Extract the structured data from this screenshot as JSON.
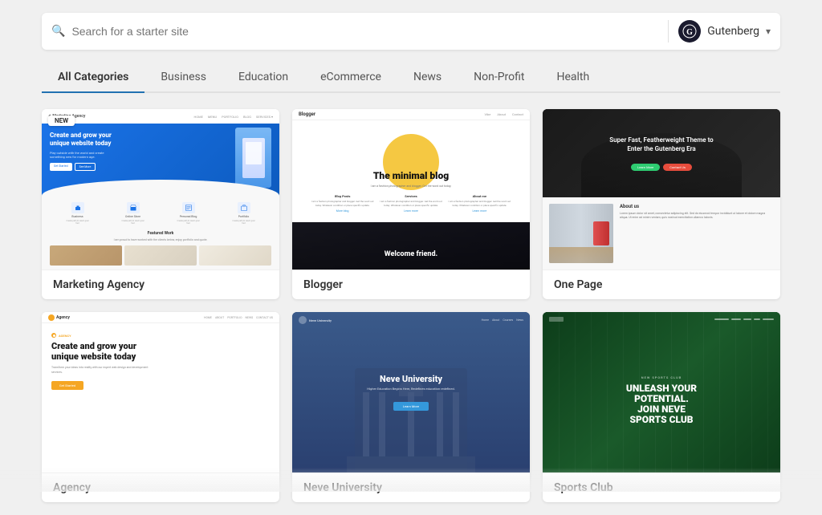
{
  "search": {
    "placeholder": "Search for a starter site"
  },
  "selector": {
    "logo_text": "G",
    "label": "Gutenberg",
    "chevron": "▾"
  },
  "categories": {
    "tabs": [
      {
        "id": "all",
        "label": "All Categories",
        "active": true
      },
      {
        "id": "business",
        "label": "Business",
        "active": false
      },
      {
        "id": "education",
        "label": "Education",
        "active": false
      },
      {
        "id": "ecommerce",
        "label": "eCommerce",
        "active": false
      },
      {
        "id": "news",
        "label": "News",
        "active": false
      },
      {
        "id": "nonprofit",
        "label": "Non-Profit",
        "active": false
      },
      {
        "id": "health",
        "label": "Health",
        "active": false
      }
    ]
  },
  "templates": {
    "row1": [
      {
        "id": "marketing-agency",
        "name": "Marketing Agency",
        "badge": "NEW",
        "hero_text": "Create and grow your unique website today"
      },
      {
        "id": "blogger",
        "name": "Blogger",
        "title": "The minimal blog",
        "bottom_text": "Welcome friend."
      },
      {
        "id": "one-page",
        "name": "One Page",
        "hero_text": "Super Fast, Featherweight Theme to Enter the Gutenberg Era",
        "about_title": "About us"
      }
    ],
    "row2": [
      {
        "id": "agency",
        "name": "Agency",
        "badge_label": "AGENCY",
        "hero_title": "Create and grow your unique website today",
        "hero_sub": "Transform your ideas into reality with our expert web design and development services."
      },
      {
        "id": "neve-university",
        "name": "Neve University",
        "subtitle": "Higher Education Begins Here, Redefines education redefined.",
        "btn": "Learn More"
      },
      {
        "id": "sports-club",
        "name": "Sports Club",
        "eyebrow": "NEW SPORTS CLUB",
        "title": "UNLEASH YOUR POTENTIAL. JOIN NEVE SPORTS CLUB FOR A..."
      }
    ]
  },
  "blog_columns": [
    {
      "title": "Blog Posts",
      "text": "I am a fashion photographer and blogger. Get the word out today. Whatever condition or place specific update."
    },
    {
      "title": "Services",
      "text": "I am a fashion photographer and blogger. Get the word out today. Whatever condition or place specific update."
    },
    {
      "title": "About me",
      "text": "I am a fashion photographer and blogger. Get the word out today. Whatever condition or place specific update."
    }
  ],
  "marketing_icons": [
    {
      "label": "Business"
    },
    {
      "label": "Online Store"
    },
    {
      "label": "Personal Blog"
    },
    {
      "label": "Portfolio"
    }
  ]
}
